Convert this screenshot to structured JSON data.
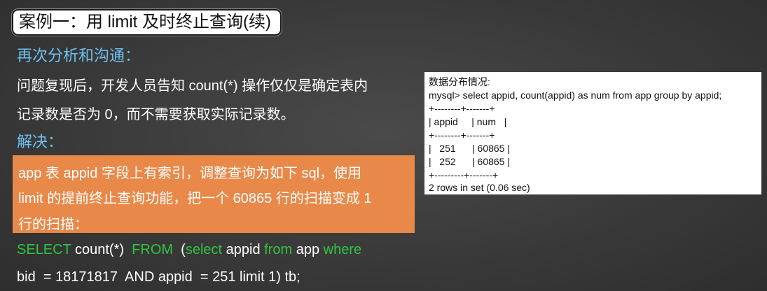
{
  "title": "案例一：用 limit 及时终止查询(续)",
  "section1": {
    "heading": "再次分析和沟通：",
    "line1": "问题复现后，开发人员告知 count(*) 操作仅仅是确定表内",
    "line2": "记录数是否为 0，而不需要获取实际记录数。"
  },
  "section2": {
    "heading": "解决：",
    "highlight_line1": "app 表 appid 字段上有索引，调整查询为如下 sql，使用",
    "highlight_line2": "limit 的提前终止查询功能，把一个 60865 行的扫描变成 1",
    "highlight_line3": "行的扫描："
  },
  "sql": {
    "kw_select": "SELECT",
    "t1": " count(*)  ",
    "kw_from": "FROM",
    "t2": "  (",
    "kw_select2": "select",
    "t3": " appid ",
    "kw_from2": "from",
    "t4": " app ",
    "kw_where": "where",
    "line2": "bid  = 18171817  AND appid  = 251 limit 1) tb;"
  },
  "mysql_panel": {
    "caption": "数据分布情况:",
    "command": "mysql> select appid, count(appid) as num from app group by appid;",
    "border1": "+--------+-------+",
    "header": "| appid     | num   |",
    "border2": "+--------+-------+",
    "row1": "|   251      | 60865 |",
    "row2": "|   252      | 60865 |",
    "border3": "+---------+-------+",
    "footer": "2 rows in set (0.06 sec)"
  }
}
